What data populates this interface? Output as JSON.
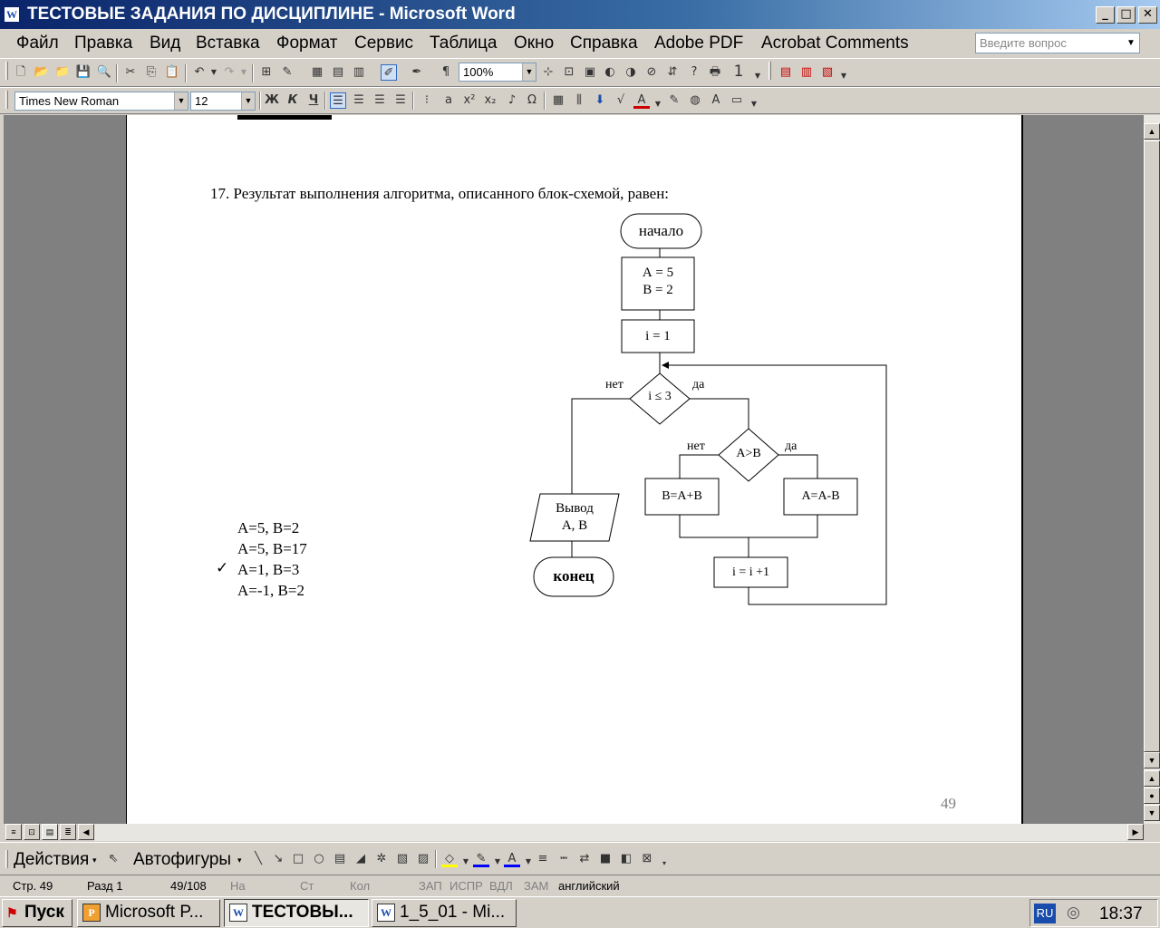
{
  "window": {
    "title": "ТЕСТОВЫЕ ЗАДАНИЯ ПО ДИСЦИПЛИНЕ - Microsoft Word",
    "app_icon": "W",
    "minimize": "_",
    "maximize": "□",
    "close": "✕"
  },
  "menu": {
    "items": [
      "Файл",
      "Правка",
      "Вид",
      "Вставка",
      "Формат",
      "Сервис",
      "Таблица",
      "Окно",
      "Справка",
      "Adobe PDF",
      "Acrobat Comments"
    ],
    "ask_placeholder": "Введите вопрос"
  },
  "toolbar": {
    "zoom": "100%",
    "pages_count": "1",
    "font_name": "Times New Roman",
    "font_size": "12",
    "bold": "Ж",
    "italic": "К",
    "underline": "Ч",
    "pilcrow": "¶"
  },
  "document": {
    "question": "17. Результат выполнения алгоритма, описанного блок-схемой, равен:",
    "answers": [
      "А=5, В=2",
      "А=5, В=17",
      "А=1, В=3",
      "А=-1, В=2"
    ],
    "correct_mark": "✓",
    "page_number": "49",
    "flowchart": {
      "start": "начало",
      "init_a": "А = 5",
      "init_b": "В = 2",
      "init_i": "i  = 1",
      "cond1": "i ≤ 3",
      "cond1_no": "нет",
      "cond1_yes": "да",
      "cond2": "А>В",
      "cond2_no": "нет",
      "cond2_yes": "да",
      "branch_no": "В=А+В",
      "branch_yes": "А=А-В",
      "increment": "i  = i +1",
      "output_line1": "Вывод",
      "output_line2": "А, В",
      "end": "конец"
    }
  },
  "drawing": {
    "actions": "Действия",
    "autoshapes": "Автофигуры"
  },
  "status": {
    "page": "Стр. 49",
    "section": "Разд 1",
    "page_of": "49/108",
    "at": "На",
    "line": "Ст",
    "col": "Кол",
    "rec": "ЗАП",
    "trk": "ИСПР",
    "ext": "ВДЛ",
    "ovr": "ЗАМ",
    "language": "английский"
  },
  "taskbar": {
    "start": "Пуск",
    "tasks": [
      "Microsoft P...",
      "ТЕСТОВЫ...",
      "1_5_01 - Mi..."
    ],
    "lang": "RU",
    "clock": "18:37"
  }
}
